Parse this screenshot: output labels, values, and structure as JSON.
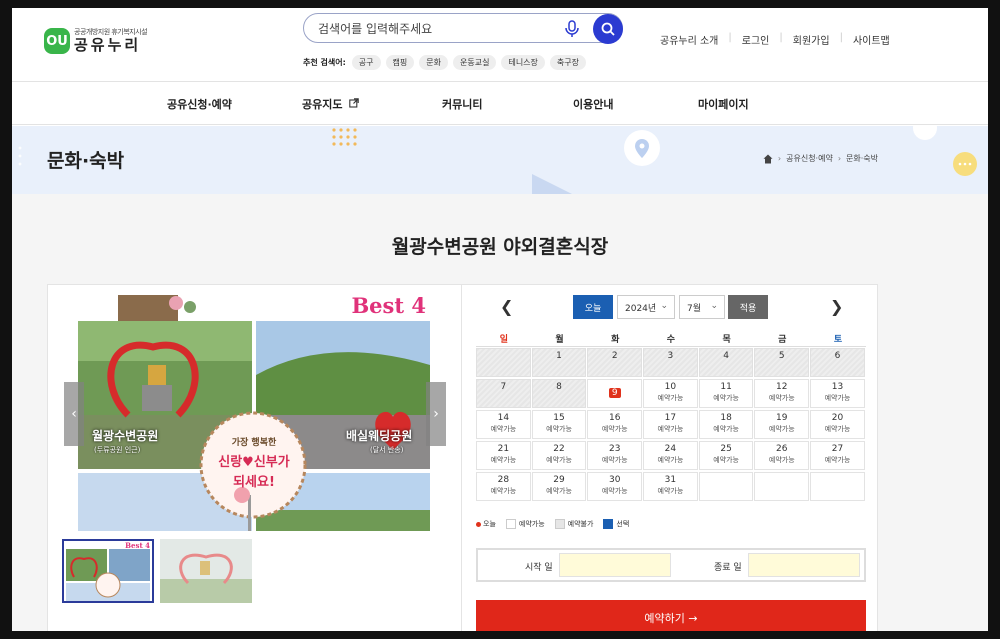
{
  "header": {
    "logo_mark": "OU",
    "logo_sub": "공공개방지원 휴기복지시설",
    "logo_main": "공유누리",
    "search_placeholder": "검색어를 입력해주세요",
    "rec_label": "추천 검색어:",
    "rec_tags": [
      "공구",
      "캠핑",
      "문화",
      "운동교실",
      "테니스장",
      "축구장"
    ],
    "util": [
      "공유누리 소개",
      "로그인",
      "회원가입",
      "사이트맵"
    ]
  },
  "gnb": [
    "공유신청·예약",
    "공유지도",
    "커뮤니티",
    "이용안내",
    "마이페이지"
  ],
  "subvisual": {
    "heading": "문화·숙박",
    "crumb": [
      "공유신청·예약",
      "문화·숙박"
    ]
  },
  "main": {
    "title": "월광수변공원 야외결혼식장"
  },
  "gallery": {
    "badge": "Best 4",
    "caption_left": "월광수변공원",
    "caption_left_sub": "(두류공원 인근)",
    "caption_right": "배실웨딩공원",
    "caption_right_sub": "(달서 반송)",
    "badge_line1": "가장 행복한",
    "badge_line2": "신랑♥신부가",
    "badge_line3": "되세요!"
  },
  "calendar": {
    "today_label": "오늘",
    "year": "2024년",
    "month": "7월",
    "apply_label": "적용",
    "dow": [
      "일",
      "월",
      "화",
      "수",
      "목",
      "금",
      "토"
    ],
    "weeks": [
      [
        {
          "n": "",
          "off": true
        },
        {
          "n": "1",
          "off": true
        },
        {
          "n": "2",
          "off": true
        },
        {
          "n": "3",
          "off": true
        },
        {
          "n": "4",
          "off": true
        },
        {
          "n": "5",
          "off": true
        },
        {
          "n": "6",
          "off": true
        }
      ],
      [
        {
          "n": "7",
          "off": true
        },
        {
          "n": "8",
          "off": true
        },
        {
          "n": "9",
          "today": true
        },
        {
          "n": "10",
          "s": "예약가능"
        },
        {
          "n": "11",
          "s": "예약가능"
        },
        {
          "n": "12",
          "s": "예약가능"
        },
        {
          "n": "13",
          "s": "예약가능"
        }
      ],
      [
        {
          "n": "14",
          "s": "예약가능"
        },
        {
          "n": "15",
          "s": "예약가능"
        },
        {
          "n": "16",
          "s": "예약가능"
        },
        {
          "n": "17",
          "s": "예약가능"
        },
        {
          "n": "18",
          "s": "예약가능"
        },
        {
          "n": "19",
          "s": "예약가능"
        },
        {
          "n": "20",
          "s": "예약가능"
        }
      ],
      [
        {
          "n": "21",
          "s": "예약가능"
        },
        {
          "n": "22",
          "s": "예약가능"
        },
        {
          "n": "23",
          "s": "예약가능"
        },
        {
          "n": "24",
          "s": "예약가능"
        },
        {
          "n": "25",
          "s": "예약가능"
        },
        {
          "n": "26",
          "s": "예약가능"
        },
        {
          "n": "27",
          "s": "예약가능"
        }
      ],
      [
        {
          "n": "28",
          "s": "예약가능"
        },
        {
          "n": "29",
          "s": "예약가능"
        },
        {
          "n": "30",
          "s": "예약가능"
        },
        {
          "n": "31",
          "s": "예약가능"
        },
        {
          "n": ""
        },
        {
          "n": ""
        },
        {
          "n": ""
        }
      ]
    ],
    "legend": [
      "오늘",
      "예약가능",
      "예약불가",
      "선택"
    ],
    "start_label": "시작 일",
    "end_label": "종료 일",
    "reserve_label": "예약하기 →"
  },
  "colors": {
    "accent_blue": "#1b5fb2",
    "reserve_red": "#e0271a",
    "search_blue": "#2b3bd1",
    "logo_green": "#39b54a"
  }
}
